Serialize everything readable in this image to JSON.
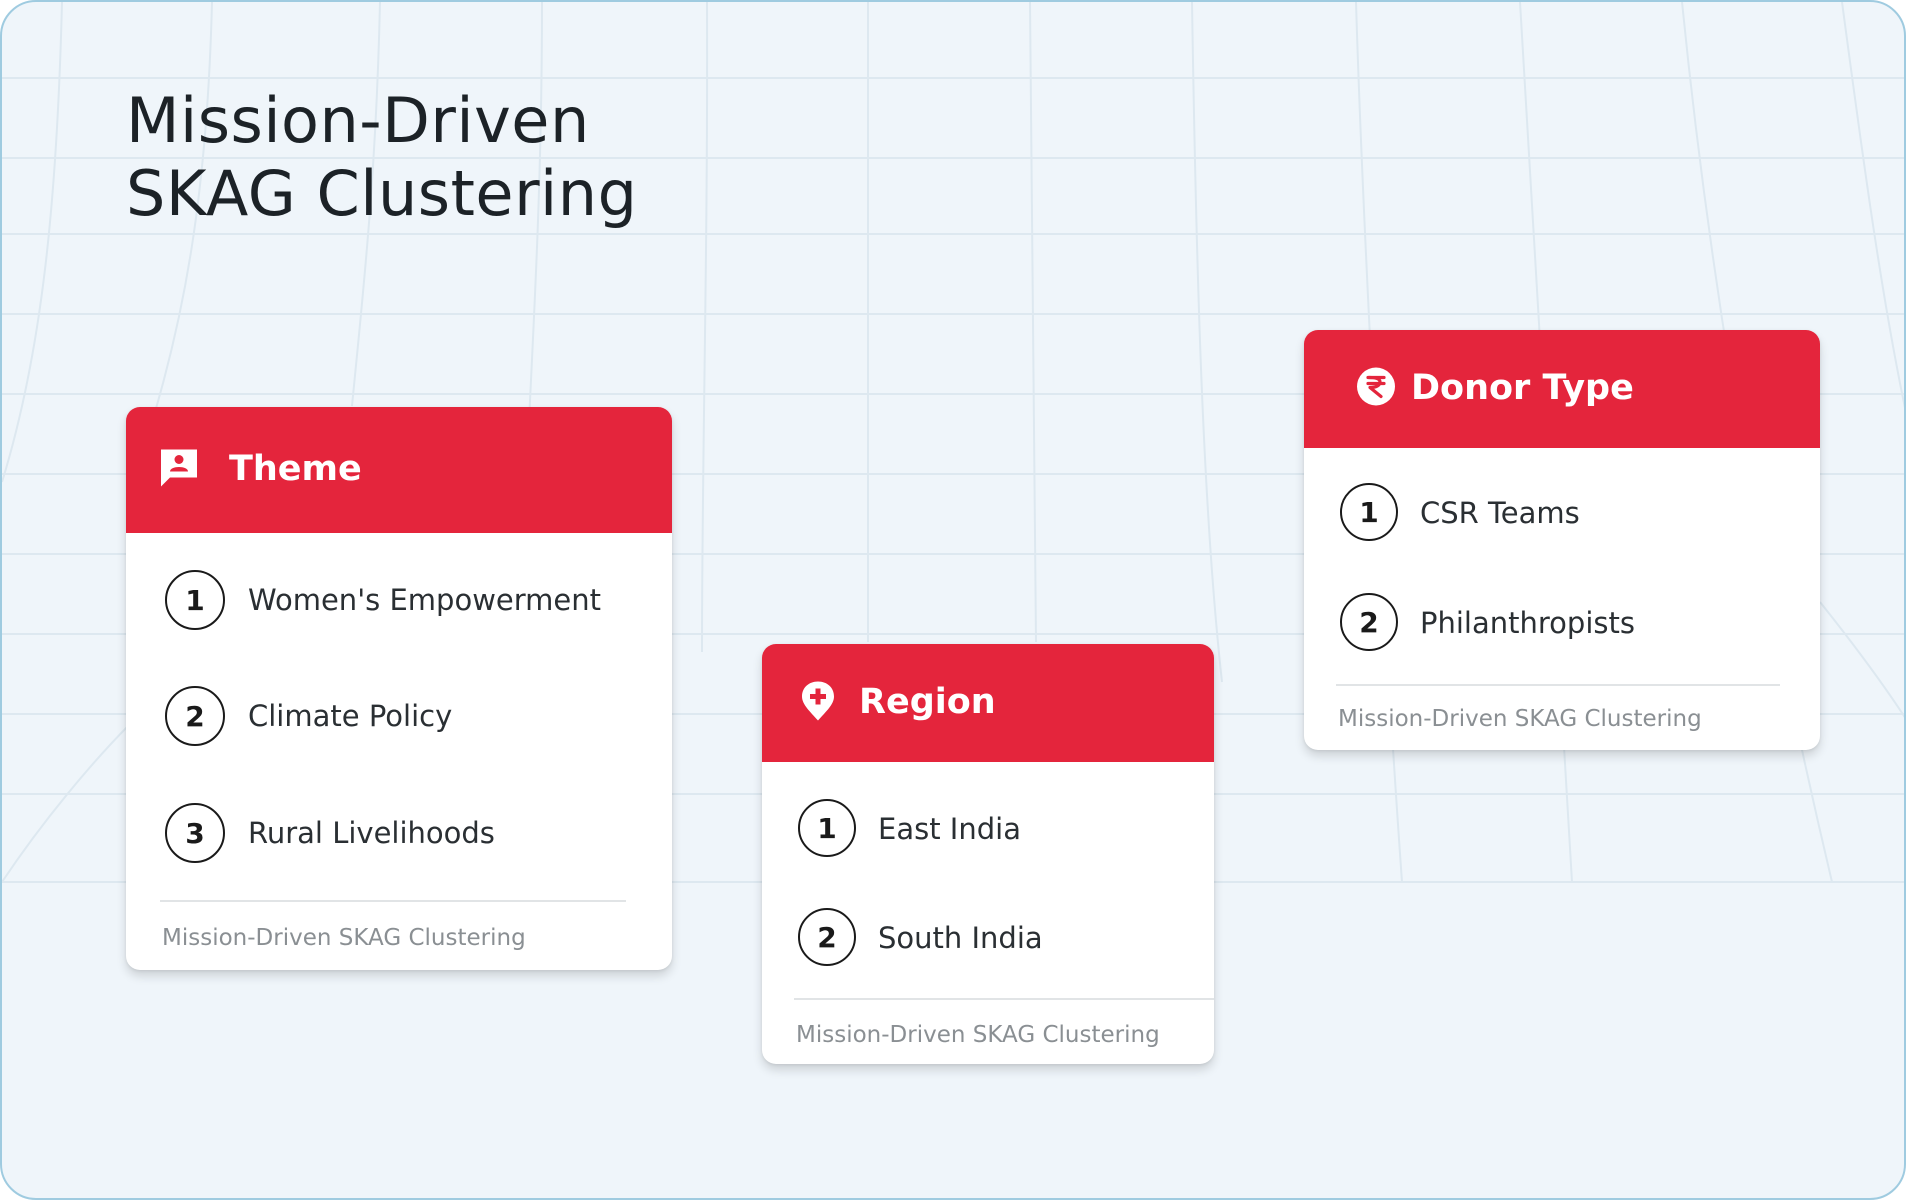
{
  "title": {
    "line1": "Mission-Driven",
    "line2": "SKAG Clustering"
  },
  "colors": {
    "accent": "#e4253c",
    "background": "#eff5fa",
    "frame_border": "#9fcbe0",
    "grid_line": "#dde8f0"
  },
  "cards": [
    {
      "title": "Theme",
      "icon": "person-chat-icon",
      "items": [
        {
          "number": "1",
          "label": "Women's Empowerment"
        },
        {
          "number": "2",
          "label": "Climate Policy"
        },
        {
          "number": "3",
          "label": "Rural Livelihoods"
        }
      ],
      "footer": "Mission-Driven SKAG Clustering"
    },
    {
      "title": "Region",
      "icon": "location-plus-icon",
      "items": [
        {
          "number": "1",
          "label": "East India"
        },
        {
          "number": "2",
          "label": "South India"
        }
      ],
      "footer": "Mission-Driven SKAG Clustering"
    },
    {
      "title": "Donor Type",
      "icon": "rupee-icon",
      "items": [
        {
          "number": "1",
          "label": "CSR Teams"
        },
        {
          "number": "2",
          "label": "Philanthropists"
        }
      ],
      "footer": "Mission-Driven SKAG Clustering"
    }
  ]
}
